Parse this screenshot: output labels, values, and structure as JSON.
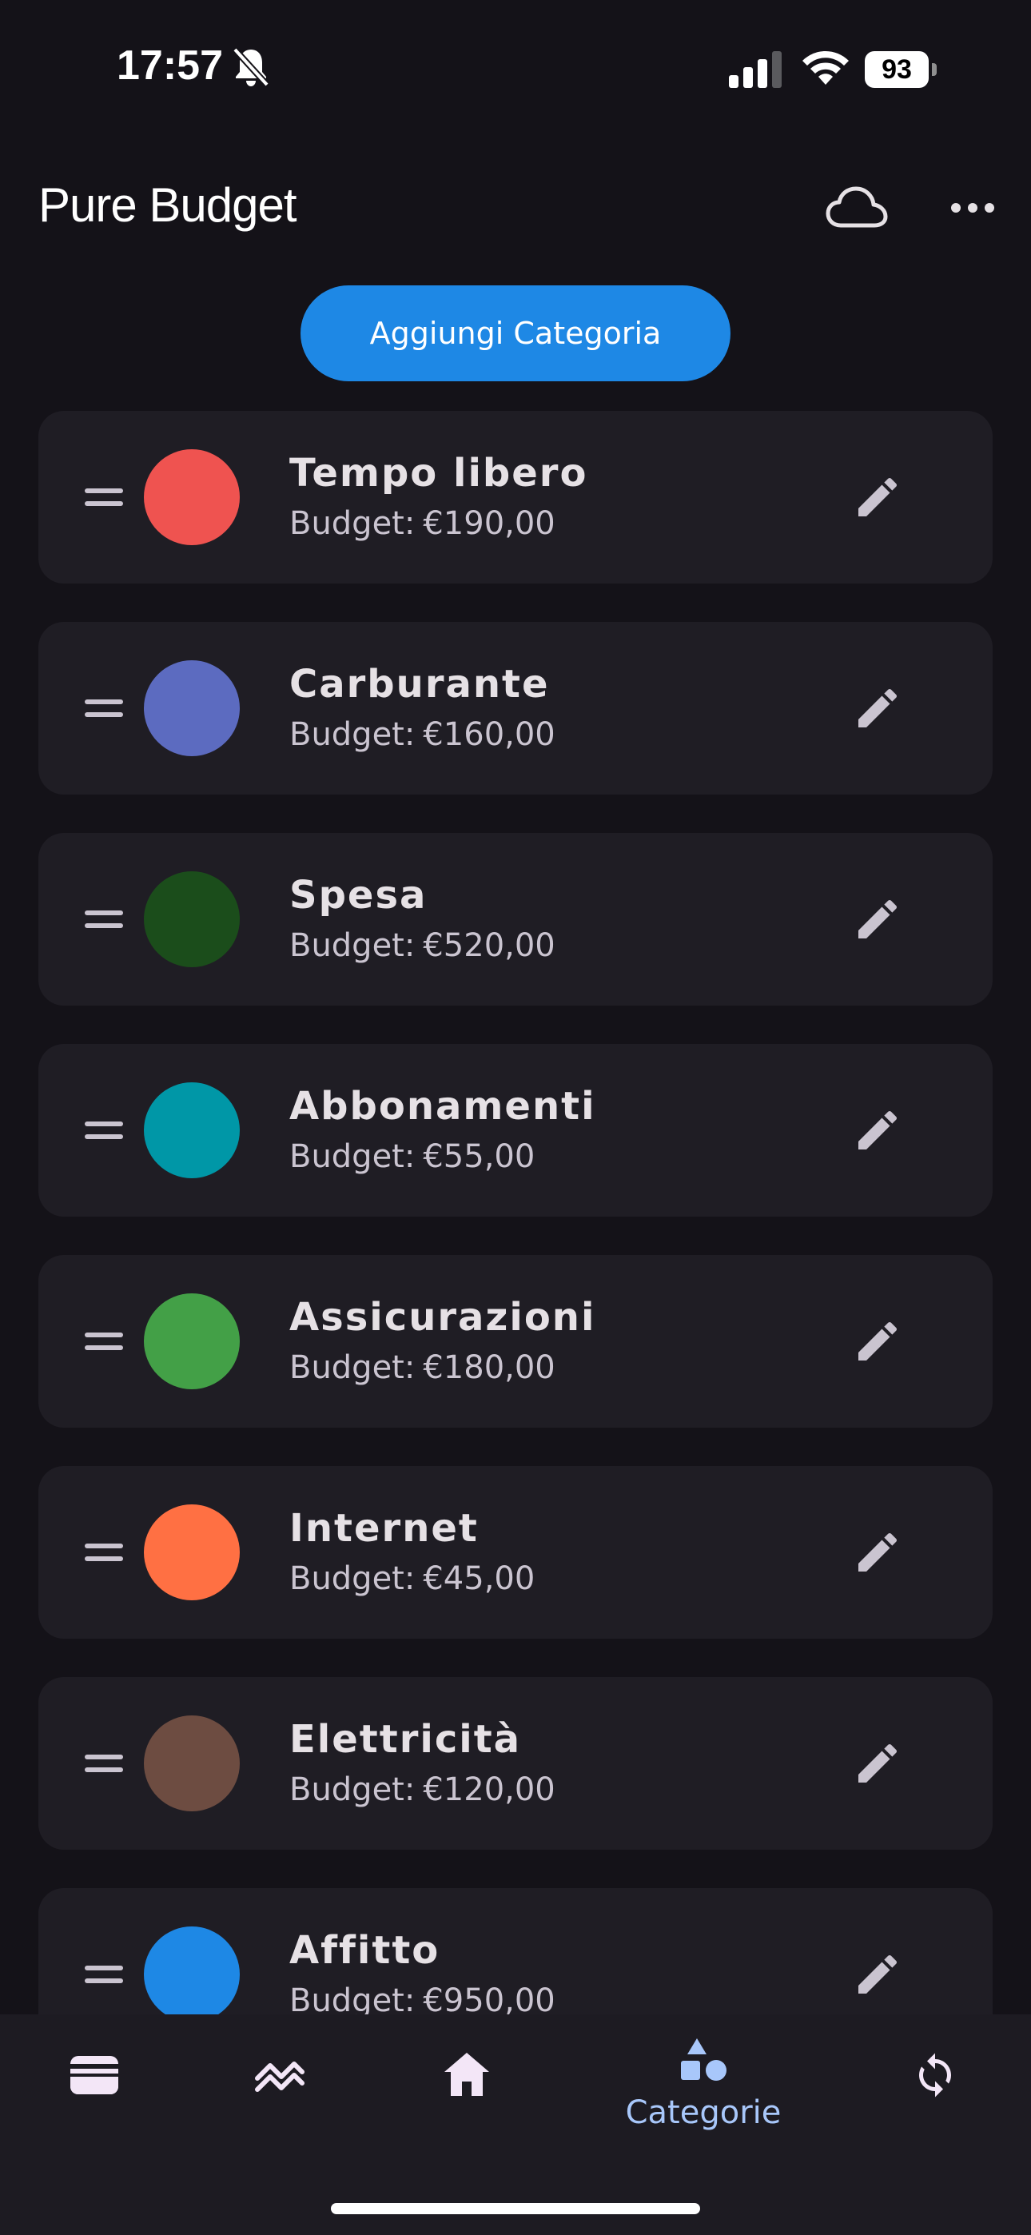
{
  "status_bar": {
    "time": "17:57",
    "battery": "93"
  },
  "app_bar": {
    "title": "Pure Budget",
    "icons": [
      "cloud-icon",
      "more-horiz-icon"
    ]
  },
  "actions": {
    "add_category_label": "Aggiungi Categoria"
  },
  "categories": [
    {
      "name": "Tempo libero",
      "budget_prefix": "Budget:",
      "budget_value": "€190,00",
      "color": "#ef5350"
    },
    {
      "name": "Carburante",
      "budget_prefix": "Budget:",
      "budget_value": "€160,00",
      "color": "#5c6bc0"
    },
    {
      "name": "Spesa",
      "budget_prefix": "Budget:",
      "budget_value": "€520,00",
      "color": "#1b4d1b"
    },
    {
      "name": "Abbonamenti",
      "budget_prefix": "Budget:",
      "budget_value": "€55,00",
      "color": "#0097a7"
    },
    {
      "name": "Assicurazioni",
      "budget_prefix": "Budget:",
      "budget_value": "€180,00",
      "color": "#43a047"
    },
    {
      "name": "Internet",
      "budget_prefix": "Budget:",
      "budget_value": "€45,00",
      "color": "#ff7043"
    },
    {
      "name": "Elettricità",
      "budget_prefix": "Budget:",
      "budget_value": "€120,00",
      "color": "#6d4c41"
    },
    {
      "name": "Affitto",
      "budget_prefix": "Budget:",
      "budget_value": "€950,00",
      "color": "#1e88e5"
    }
  ],
  "bottom_nav": {
    "items": [
      {
        "icon": "wallet-icon",
        "label": ""
      },
      {
        "icon": "trending-icon",
        "label": ""
      },
      {
        "icon": "home-icon",
        "label": ""
      },
      {
        "icon": "category-icon",
        "label": "Categorie",
        "selected": true
      },
      {
        "icon": "sync-icon",
        "label": ""
      }
    ]
  },
  "colors": {
    "background": "#141218",
    "card": "#1f1d24",
    "accent": "#1e88e5",
    "nav_selected": "#a8c7fa"
  }
}
